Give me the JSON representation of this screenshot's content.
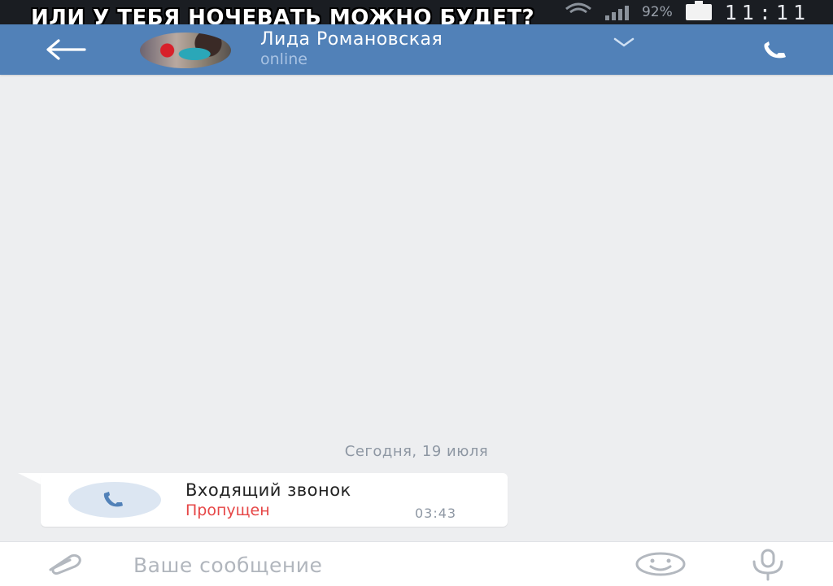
{
  "meme_caption": "ИЛИ У ТЕБЯ НОЧЕВАТЬ МОЖНО БУДЕТ?",
  "status_bar": {
    "battery_percent": "92%",
    "time": "11:11"
  },
  "header": {
    "contact_name": "Лида Романовская",
    "contact_status": "online"
  },
  "chat": {
    "date_separator": "Сегодня, 19 июля",
    "messages": [
      {
        "type": "call",
        "title": "Входящий звонок",
        "status": "Пропущен",
        "time": "03:43"
      }
    ]
  },
  "composer": {
    "placeholder": "Ваше сообщение"
  },
  "colors": {
    "header_bg": "#5181b8",
    "chat_bg": "#edeef0",
    "missed_red": "#e64646"
  },
  "icons": {
    "back": "arrow-left-icon",
    "call": "phone-icon",
    "attach": "paperclip-icon",
    "emoji": "smiley-icon",
    "mic": "microphone-icon"
  }
}
